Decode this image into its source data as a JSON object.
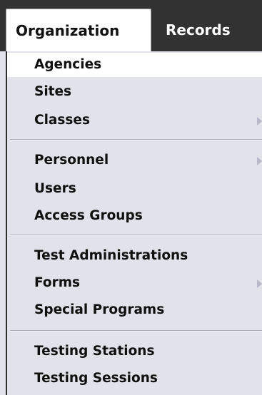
{
  "menubar": {
    "tabs": [
      {
        "label": "Organization",
        "active": true
      },
      {
        "label": "Records",
        "active": false
      }
    ]
  },
  "menu": {
    "groups": [
      [
        {
          "label": "Agencies",
          "highlighted": true,
          "has_submenu": false
        },
        {
          "label": "Sites",
          "highlighted": false,
          "has_submenu": false
        },
        {
          "label": "Classes",
          "highlighted": false,
          "has_submenu": true
        }
      ],
      [
        {
          "label": "Personnel",
          "highlighted": false,
          "has_submenu": true
        },
        {
          "label": "Users",
          "highlighted": false,
          "has_submenu": false
        },
        {
          "label": "Access Groups",
          "highlighted": false,
          "has_submenu": false
        }
      ],
      [
        {
          "label": "Test Administrations",
          "highlighted": false,
          "has_submenu": false
        },
        {
          "label": "Forms",
          "highlighted": false,
          "has_submenu": true
        },
        {
          "label": "Special Programs",
          "highlighted": false,
          "has_submenu": false
        }
      ],
      [
        {
          "label": "Testing Stations",
          "highlighted": false,
          "has_submenu": false
        },
        {
          "label": "Testing Sessions",
          "highlighted": false,
          "has_submenu": false
        }
      ]
    ]
  },
  "colors": {
    "menubar_bg": "#323232",
    "menu_bg": "#e2e2ea",
    "highlight_bg": "#ffffff",
    "submenu_arrow": "#b8b8c8"
  },
  "icons": {
    "submenu": "chevron-right-icon"
  }
}
